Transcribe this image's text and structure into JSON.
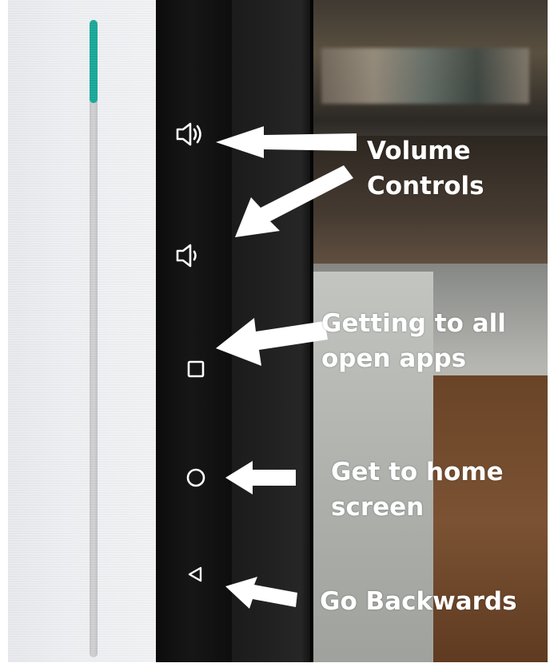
{
  "volume_slider": {
    "level_percent": 13,
    "accent_color": "#16a89a"
  },
  "nav_bar": {
    "buttons": [
      {
        "name": "volume-up",
        "icon": "speaker-loud-icon"
      },
      {
        "name": "volume-down",
        "icon": "speaker-quiet-icon"
      },
      {
        "name": "recents",
        "icon": "square-icon"
      },
      {
        "name": "home",
        "icon": "circle-icon"
      },
      {
        "name": "back",
        "icon": "triangle-left-icon"
      }
    ]
  },
  "annotations": {
    "volume": {
      "line1": "Volume",
      "line2": "Controls"
    },
    "apps": {
      "line1": "Getting to all",
      "line2": "open apps"
    },
    "home": {
      "line1": "Get to home",
      "line2": "screen"
    },
    "back": {
      "line1": "Go Backwards"
    }
  }
}
